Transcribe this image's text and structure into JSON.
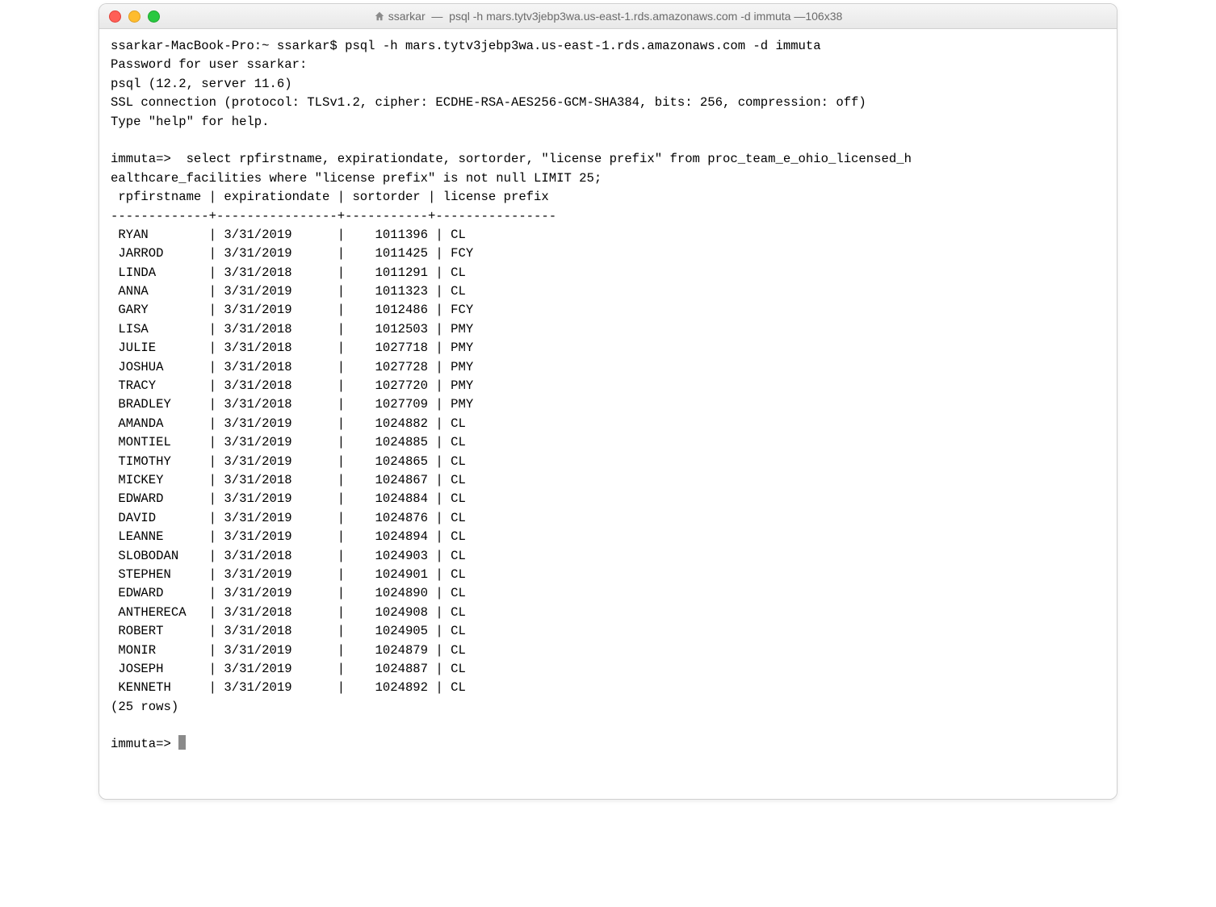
{
  "window": {
    "title_folder": "ssarkar",
    "title_cmd": "psql -h mars.tytv3jebp3wa.us-east-1.rds.amazonaws.com -d immuta",
    "title_size": "106x38"
  },
  "session": {
    "shell_prompt": "ssarkar-MacBook-Pro:~ ssarkar$ ",
    "shell_cmd": "psql -h mars.tytv3jebp3wa.us-east-1.rds.amazonaws.com -d immuta",
    "pw_prompt": "Password for user ssarkar: ",
    "version_line": "psql (12.2, server 11.6)",
    "ssl_line": "SSL connection (protocol: TLSv1.2, cipher: ECDHE-RSA-AES256-GCM-SHA384, bits: 256, compression: off)",
    "help_line": "Type \"help\" for help.",
    "psql_prompt": "immuta=>  ",
    "psql_prompt_short": "immuta=> ",
    "sql_line1": "select rpfirstname, expirationdate, sortorder, \"license prefix\" from proc_team_e_ohio_licensed_h",
    "sql_line2": "ealthcare_facilities where \"license prefix\" is not null LIMIT 25;"
  },
  "table": {
    "header": " rpfirstname | expirationdate | sortorder | license prefix ",
    "sep": "-------------+----------------+-----------+----------------",
    "rows": [
      {
        "c1": "RYAN",
        "c2": "3/31/2019",
        "c3": "1011396",
        "c4": "CL"
      },
      {
        "c1": "JARROD",
        "c2": "3/31/2019",
        "c3": "1011425",
        "c4": "FCY"
      },
      {
        "c1": "LINDA",
        "c2": "3/31/2018",
        "c3": "1011291",
        "c4": "CL"
      },
      {
        "c1": "ANNA",
        "c2": "3/31/2019",
        "c3": "1011323",
        "c4": "CL"
      },
      {
        "c1": "GARY",
        "c2": "3/31/2019",
        "c3": "1012486",
        "c4": "FCY"
      },
      {
        "c1": "LISA",
        "c2": "3/31/2018",
        "c3": "1012503",
        "c4": "PMY"
      },
      {
        "c1": "JULIE",
        "c2": "3/31/2018",
        "c3": "1027718",
        "c4": "PMY"
      },
      {
        "c1": "JOSHUA",
        "c2": "3/31/2018",
        "c3": "1027728",
        "c4": "PMY"
      },
      {
        "c1": "TRACY",
        "c2": "3/31/2018",
        "c3": "1027720",
        "c4": "PMY"
      },
      {
        "c1": "BRADLEY",
        "c2": "3/31/2018",
        "c3": "1027709",
        "c4": "PMY"
      },
      {
        "c1": "AMANDA",
        "c2": "3/31/2019",
        "c3": "1024882",
        "c4": "CL"
      },
      {
        "c1": "MONTIEL",
        "c2": "3/31/2019",
        "c3": "1024885",
        "c4": "CL"
      },
      {
        "c1": "TIMOTHY",
        "c2": "3/31/2019",
        "c3": "1024865",
        "c4": "CL"
      },
      {
        "c1": "MICKEY",
        "c2": "3/31/2018",
        "c3": "1024867",
        "c4": "CL"
      },
      {
        "c1": "EDWARD",
        "c2": "3/31/2019",
        "c3": "1024884",
        "c4": "CL"
      },
      {
        "c1": "DAVID",
        "c2": "3/31/2019",
        "c3": "1024876",
        "c4": "CL"
      },
      {
        "c1": "LEANNE",
        "c2": "3/31/2019",
        "c3": "1024894",
        "c4": "CL"
      },
      {
        "c1": "SLOBODAN",
        "c2": "3/31/2018",
        "c3": "1024903",
        "c4": "CL"
      },
      {
        "c1": "STEPHEN",
        "c2": "3/31/2019",
        "c3": "1024901",
        "c4": "CL"
      },
      {
        "c1": "EDWARD",
        "c2": "3/31/2019",
        "c3": "1024890",
        "c4": "CL"
      },
      {
        "c1": "ANTHERECA",
        "c2": "3/31/2018",
        "c3": "1024908",
        "c4": "CL"
      },
      {
        "c1": "ROBERT",
        "c2": "3/31/2018",
        "c3": "1024905",
        "c4": "CL"
      },
      {
        "c1": "MONIR",
        "c2": "3/31/2019",
        "c3": "1024879",
        "c4": "CL"
      },
      {
        "c1": "JOSEPH",
        "c2": "3/31/2019",
        "c3": "1024887",
        "c4": "CL"
      },
      {
        "c1": "KENNETH",
        "c2": "3/31/2019",
        "c3": "1024892",
        "c4": "CL"
      }
    ],
    "footer": "(25 rows)"
  }
}
